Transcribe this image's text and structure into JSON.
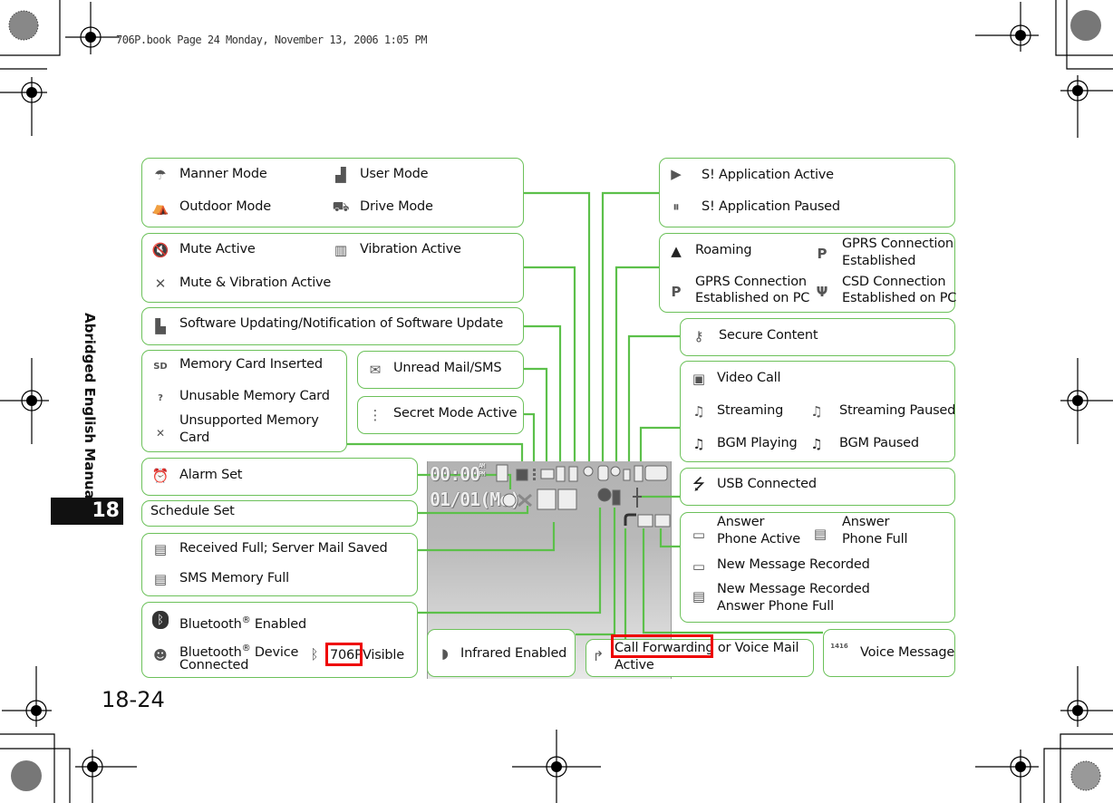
{
  "header": {
    "print_info": "706P.book  Page 24  Monday, November 13, 2006  1:05 PM"
  },
  "sidebar": {
    "title": "Abridged English Manual",
    "chapter": "18"
  },
  "footer": {
    "page_number": "18-24"
  },
  "colors": {
    "connector": "#5cc04a",
    "box_border": "#6cc15a",
    "highlight": "#ee0000",
    "screen": "#b5b5b5"
  },
  "phone_screen": {
    "time": "00:00",
    "ampm_top": "AM",
    "ampm_bottom": "PM",
    "date": "01/01(Mo)"
  },
  "left_groups": {
    "mode": {
      "items": [
        {
          "icon": "manner-mode-icon",
          "label": "Manner Mode"
        },
        {
          "icon": "user-mode-icon",
          "label": "User Mode"
        },
        {
          "icon": "outdoor-mode-icon",
          "label": "Outdoor Mode"
        },
        {
          "icon": "drive-mode-icon",
          "label": "Drive Mode"
        }
      ]
    },
    "mute": {
      "items": [
        {
          "icon": "mute-icon",
          "label": "Mute Active"
        },
        {
          "icon": "vibration-icon",
          "label": "Vibration Active"
        },
        {
          "icon": "mute-vibration-icon",
          "label": "Mute & Vibration Active"
        }
      ]
    },
    "software": {
      "label": "Software Updating/Notification of Software Update"
    },
    "memory": {
      "items": [
        {
          "icon": "sd-card-icon",
          "label": "Memory Card Inserted"
        },
        {
          "icon": "sd-card-unusable-icon",
          "label": "Unusable Memory Card"
        },
        {
          "icon": "sd-card-unsupported-icon",
          "label_line1": "Unsupported Memory",
          "label_line2": "Card"
        }
      ]
    },
    "unread": {
      "label": "Unread Mail/SMS"
    },
    "secret": {
      "label": "Secret Mode Active"
    },
    "alarm": {
      "label": "Alarm Set"
    },
    "schedule": {
      "label": "Schedule Set"
    },
    "mail_full": {
      "items": [
        {
          "icon": "received-full-icon",
          "label": "Received Full; Server Mail Saved"
        },
        {
          "icon": "sms-full-icon",
          "label": "SMS Memory Full"
        }
      ]
    },
    "bluetooth": {
      "enabled": "Bluetooth",
      "enabled_suffix": " Enabled",
      "device": "Bluetooth",
      "device_suffix": " Device",
      "connected": "Connected",
      "registered": "®",
      "visible_model": "706P",
      "visible_suffix": " Visible"
    },
    "infrared": {
      "label": "Infrared Enabled"
    },
    "call_forwarding": {
      "line1_highlight": "Call Forwarding",
      "line1_rest": " or Voice Mail",
      "line2": "Active"
    }
  },
  "right_groups": {
    "sapp": {
      "items": [
        {
          "icon": "s-app-active-icon",
          "label": "S! Application Active"
        },
        {
          "icon": "s-app-paused-icon",
          "label": "S! Application Paused"
        }
      ]
    },
    "connection": {
      "roaming": "Roaming",
      "gprs_line1": "GPRS Connection",
      "gprs_line2": "Established",
      "gprs_pc_line1": "GPRS Connection",
      "gprs_pc_line2": "Established on PC",
      "csd_pc_line1": "CSD Connection",
      "csd_pc_line2": "Established on PC"
    },
    "secure": {
      "label": "Secure Content"
    },
    "media": {
      "video_call": "Video Call",
      "streaming": "Streaming",
      "streaming_paused": "Streaming Paused",
      "bgm_playing": "BGM Playing",
      "bgm_paused": "BGM Paused"
    },
    "usb": {
      "label": "USB Connected"
    },
    "answer_phone": {
      "active_line1": "Answer",
      "active_line2": "Phone Active",
      "full_line1": "Answer",
      "full_line2": "Phone Full",
      "new_message": "New Message Recorded",
      "new_full_line1": "New Message Recorded",
      "new_full_line2": "Answer Phone Full"
    },
    "voice_message": {
      "label": "Voice Message",
      "icon_digits": "1416"
    }
  }
}
